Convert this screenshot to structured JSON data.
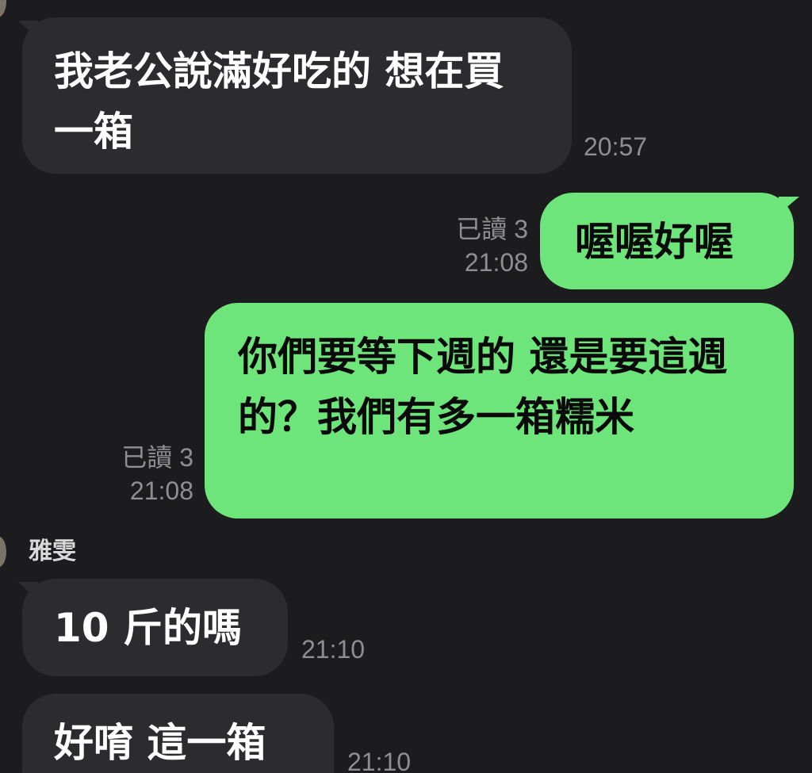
{
  "messages": [
    {
      "direction": "incoming",
      "text": "我老公說滿好吃的 想在買一箱",
      "time": "20:57"
    },
    {
      "direction": "outgoing",
      "text": "喔喔好喔",
      "read": "已讀 3",
      "time": "21:08"
    },
    {
      "direction": "outgoing",
      "text": "你們要等下週的  還是要這週的？我們有多一箱糯米",
      "read": "已讀 3",
      "time": "21:08"
    },
    {
      "direction": "incoming",
      "sender": "雅雯",
      "text": "10 斤的嗎",
      "time": "21:10"
    },
    {
      "direction": "incoming",
      "text": "好唷 這一箱",
      "time": "21:10"
    }
  ],
  "colors": {
    "background": "#1c1c1e",
    "incoming_bubble": "#2c2c2e",
    "outgoing_bubble": "#6ee57a",
    "meta_text": "#8e8e93"
  }
}
